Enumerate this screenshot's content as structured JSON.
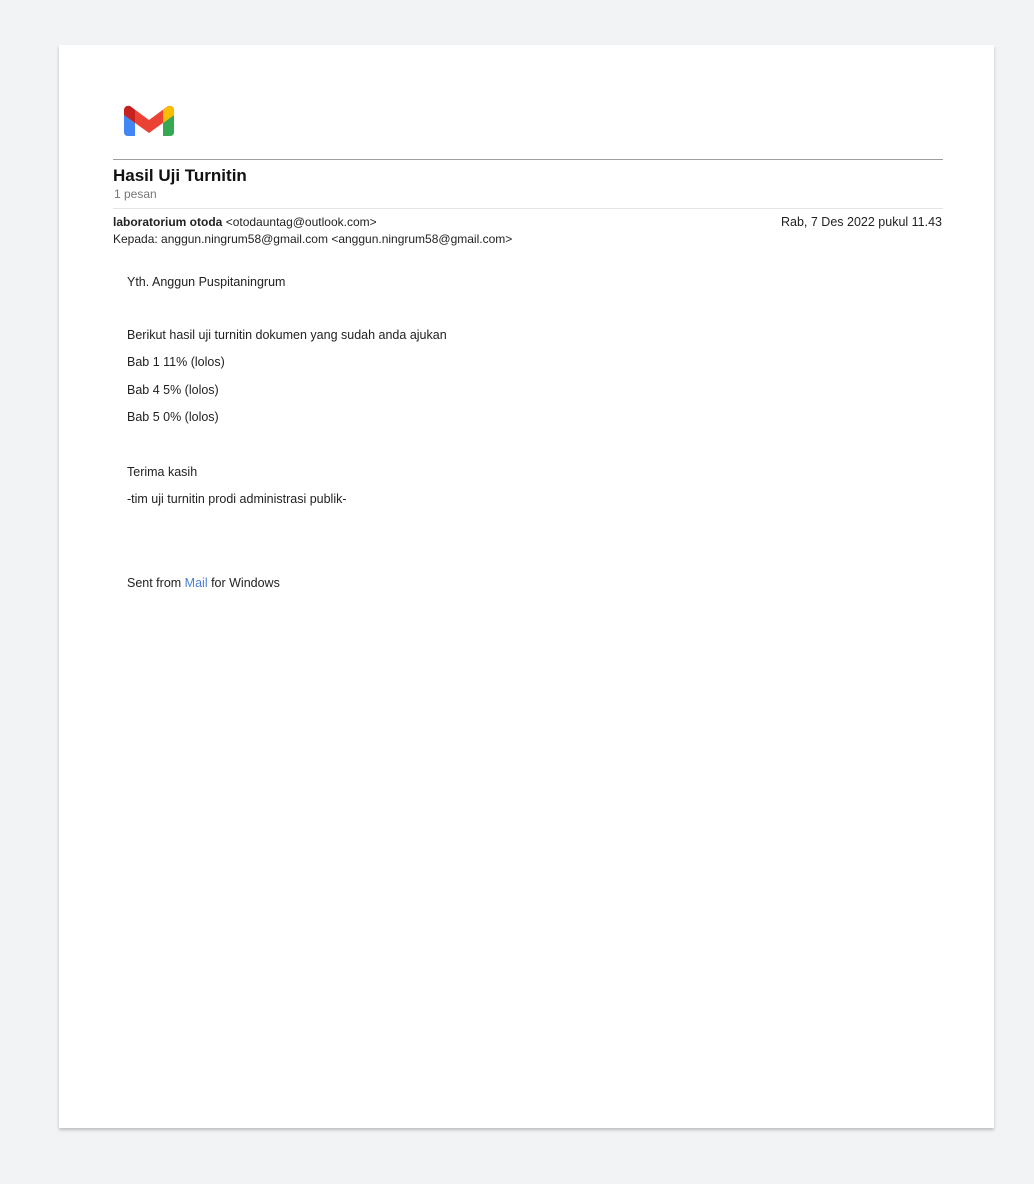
{
  "icons": {
    "logo": "gmail-logo-icon"
  },
  "colors": {
    "gmail_red": "#ea4335",
    "gmail_blue": "#4285f4",
    "gmail_green": "#34a853",
    "gmail_yellow": "#fbbc04",
    "darkred": "#c5221f",
    "link": "#4a7fd6"
  },
  "email": {
    "subject": "Hasil Uji Turnitin",
    "message_count": "1 pesan",
    "sender_name": "laboratorium otoda",
    "sender_email": "<otodauntag@outlook.com>",
    "recipient": "Kepada: anggun.ningrum58@gmail.com <anggun.ningrum58@gmail.com>",
    "date": "Rab, 7 Des 2022 pukul 11.43",
    "greeting": "Yth. Anggun Puspitaningrum",
    "intro": "Berikut hasil uji turnitin dokumen yang sudah anda ajukan",
    "results": [
      "Bab 1 11% (lolos)",
      "Bab 4 5% (lolos)",
      "Bab 5 0% (lolos)"
    ],
    "thanks": "Terima kasih",
    "signature": "-tim uji turnitin prodi administrasi publik-",
    "sent_from_prefix": "Sent from ",
    "sent_from_link": "Mail",
    "sent_from_suffix": " for Windows"
  }
}
